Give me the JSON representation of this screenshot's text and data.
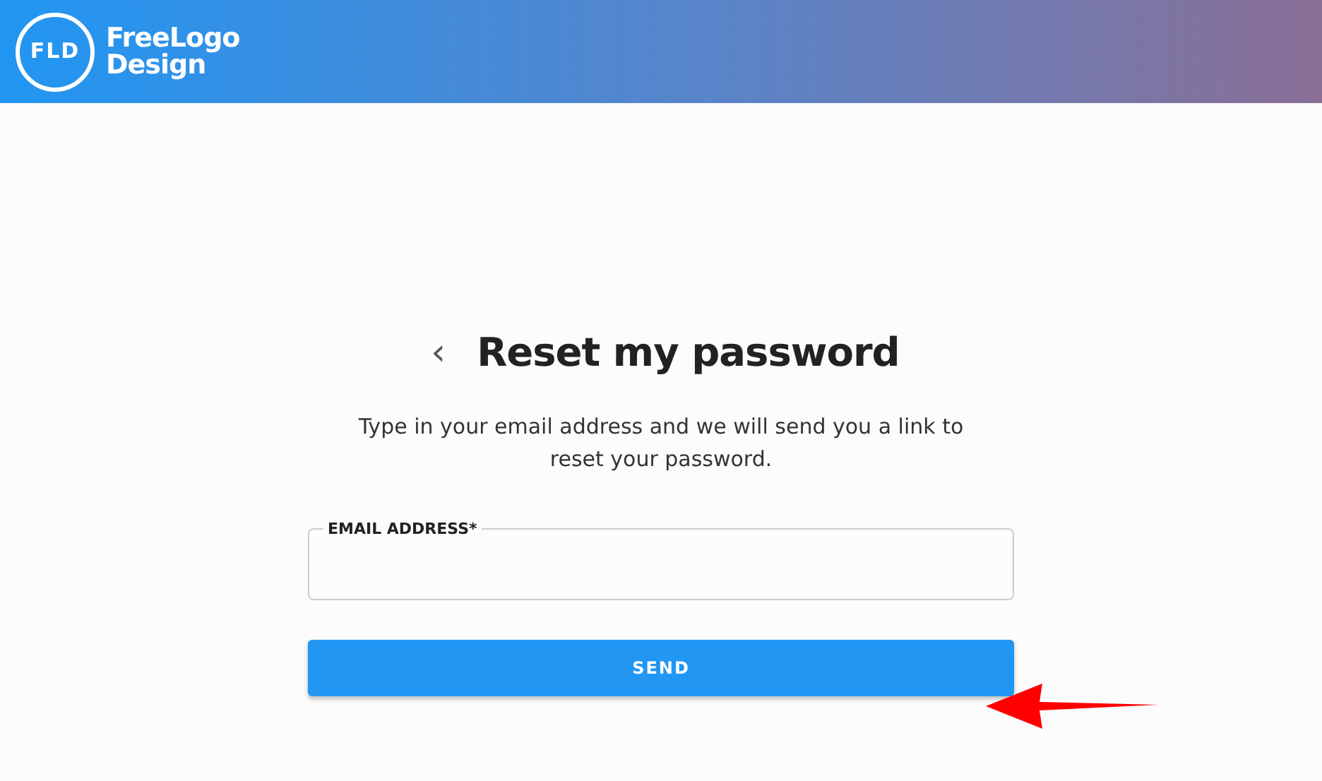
{
  "header": {
    "logo": {
      "badge": "FLD",
      "name_line_1": "FreeLogo",
      "name_line_2": "Design"
    }
  },
  "form": {
    "back": "‹",
    "title": "Reset my password",
    "description": "Type in your email address and we will send you a link to reset your password.",
    "email_field": {
      "label": "EMAIL ADDRESS*"
    },
    "submit": "SEND"
  }
}
